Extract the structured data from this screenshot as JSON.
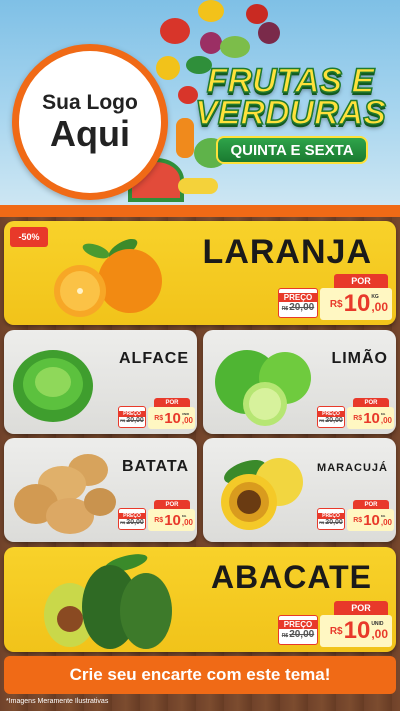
{
  "header": {
    "logo_line1": "Sua Logo",
    "logo_line2": "Aqui",
    "title_line1": "FRUTAS E",
    "title_line2": "VERDURAS",
    "days": "QUINTA E SEXTA"
  },
  "products": [
    {
      "name": "LARANJA",
      "discount": "-50%",
      "old_label": "PREÇO",
      "old_prefix": "R$",
      "old_price": "20,00",
      "por_label": "POR",
      "currency": "R$",
      "price_int": "10",
      "price_dec": ",00",
      "unit": "KG"
    },
    {
      "name": "ALFACE",
      "old_label": "PREÇO",
      "old_prefix": "R$",
      "old_price": "20,00",
      "por_label": "POR",
      "currency": "R$",
      "price_int": "10",
      "price_dec": ",00",
      "unit": "UNID"
    },
    {
      "name": "LIMÃO",
      "old_label": "PREÇO",
      "old_prefix": "R$",
      "old_price": "20,00",
      "por_label": "POR",
      "currency": "R$",
      "price_int": "10",
      "price_dec": ",00",
      "unit": "KG"
    },
    {
      "name": "BATATA",
      "old_label": "PREÇO",
      "old_prefix": "R$",
      "old_price": "20,00",
      "por_label": "POR",
      "currency": "R$",
      "price_int": "10",
      "price_dec": ",00",
      "unit": "KG"
    },
    {
      "name": "MARACUJÁ",
      "old_label": "PREÇO",
      "old_prefix": "R$",
      "old_price": "20,00",
      "por_label": "POR",
      "currency": "R$",
      "price_int": "10",
      "price_dec": ",00",
      "unit": "KG"
    },
    {
      "name": "ABACATE",
      "old_label": "PREÇO",
      "old_prefix": "R$",
      "old_price": "20,00",
      "por_label": "POR",
      "currency": "R$",
      "price_int": "10",
      "price_dec": ",00",
      "unit": "UNID"
    }
  ],
  "footer": {
    "cta": "Crie seu encarte com este tema!",
    "disclaimer": "*Imagens Meramente Ilustrativas"
  },
  "colors": {
    "accent_orange": "#f06a16",
    "price_red": "#e8392a",
    "card_yellow": "#f6cf26",
    "card_gray": "#e6e6e4",
    "title_green": "#1f7a2d"
  }
}
